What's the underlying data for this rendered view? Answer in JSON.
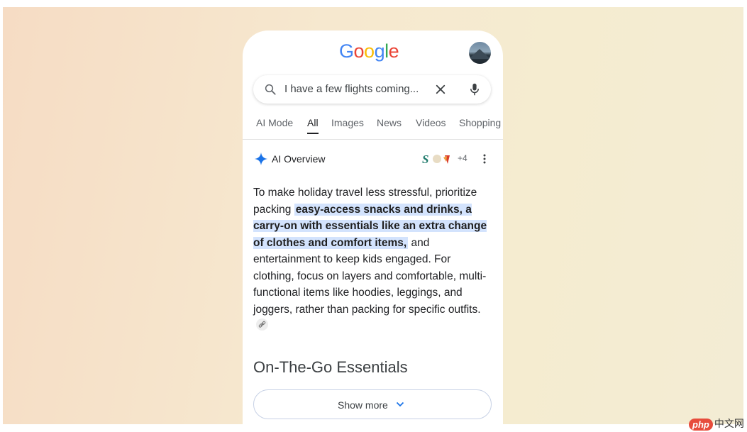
{
  "logo": {
    "letters": [
      "G",
      "o",
      "o",
      "g",
      "l",
      "e"
    ],
    "colors": [
      "#4285f4",
      "#ea4335",
      "#fbbc05",
      "#4285f4",
      "#34a853",
      "#ea4335"
    ]
  },
  "search": {
    "query": "I have a few flights coming...",
    "icons": [
      "search-icon",
      "clear-icon",
      "mic-icon"
    ]
  },
  "tabs": [
    "AI Mode",
    "All",
    "Images",
    "News",
    "Videos",
    "Shopping"
  ],
  "active_tab": "All",
  "overview": {
    "title": "AI Overview",
    "source_count": "+4",
    "accent": "#1a73e8"
  },
  "answer": {
    "part1": "To make holiday travel less stressful, prioritize packing ",
    "highlight": "easy-access snacks and drinks, a carry-on with essentials like an extra change of clothes and comfort items,",
    "part2": " and entertainment to keep kids engaged. For clothing, focus on layers and comfortable, multi-functional items like hoodies, leggings, and joggers, rather than packing for specific outfits."
  },
  "section_title": "On-The-Go Essentials",
  "show_more": "Show more",
  "watermark": {
    "brand": "php",
    "text": "中文网"
  }
}
